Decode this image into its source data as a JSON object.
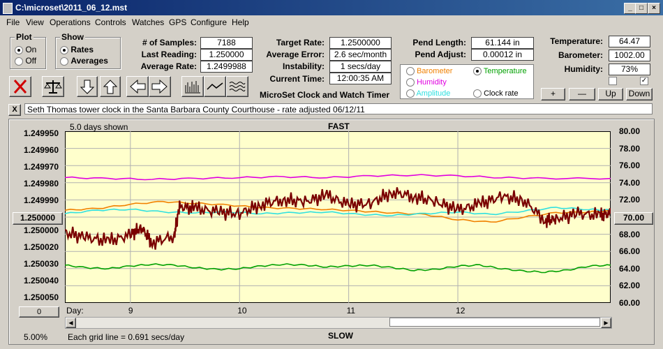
{
  "window": {
    "title": "C:\\microset\\2011_06_12.mst"
  },
  "menu": [
    "File",
    "View",
    "Operations",
    "Controls",
    "Watches",
    "GPS",
    "Configure",
    "Help"
  ],
  "plot_group": {
    "title": "Plot",
    "on": "On",
    "off": "Off"
  },
  "show_group": {
    "title": "Show",
    "rates": "Rates",
    "averages": "Averages"
  },
  "stats": {
    "samples_label": "# of Samples:",
    "samples": "7188",
    "last_label": "Last Reading:",
    "last": "1.250000",
    "avg_label": "Average Rate:",
    "avg": "1.2499988",
    "target_label": "Target Rate:",
    "target": "1.2500000",
    "err_label": "Average Error:",
    "err": "2.6 sec/month",
    "inst_label": "Instability:",
    "inst": "1 secs/day",
    "time_label": "Current Time:",
    "time": "12:00:35 AM",
    "pend_len_label": "Pend Length:",
    "pend_len": "61.144 in",
    "pend_adj_label": "Pend Adjust:",
    "pend_adj": "0.00012 in",
    "temp_label": "Temperature:",
    "temp": "64.47",
    "baro_label": "Barometer:",
    "baro": "1002.00",
    "hum_label": "Humidity:",
    "hum": "73%"
  },
  "app_label": "MicroSet Clock and Watch Timer",
  "series_select": {
    "barometer": "Barometer",
    "temperature": "Temperature",
    "humidity": "Humidity",
    "amplitude": "Amplitude",
    "clock_rate": "Clock rate"
  },
  "buttons": {
    "plus": "+",
    "minus": "—",
    "up": "Up",
    "down": "Down",
    "close_x": "X"
  },
  "comment": "Seth Thomas tower clock in the Santa Barbara County Courthouse - rate adjusted 06/12/11",
  "chart_top": {
    "days_shown": "5.0 days shown",
    "fast": "FAST",
    "slow": "SLOW"
  },
  "left_controls": {
    "center_value": "1.250000",
    "offset_value": "0"
  },
  "right_controls": {
    "center_value": "70.00"
  },
  "status": {
    "zoom": "5.00%",
    "grid": "Each grid line = 0.691 secs/day"
  },
  "colors": {
    "clock_rate": "#7a0000",
    "temperature": "#00a000",
    "humidity": "#e000e0",
    "barometer": "#f08000",
    "amplitude": "#30e0e0",
    "plot_bg": "#ffffcc"
  },
  "chart_data": {
    "type": "line",
    "xlabel": "Day:",
    "x_ticks": [
      "9",
      "10",
      "11",
      "12"
    ],
    "x_range": [
      8.4,
      13.4
    ],
    "y_left_ticks": [
      "1.249950",
      "1.249960",
      "1.249970",
      "1.249980",
      "1.249990",
      "1.250000",
      "1.250020",
      "1.250030",
      "1.250040",
      "1.250050"
    ],
    "y_right_ticks": [
      "80.00",
      "78.00",
      "76.00",
      "74.00",
      "72.00",
      "70.00",
      "68.00",
      "66.00",
      "64.00",
      "62.00",
      "60.00"
    ],
    "ylim_right": [
      60,
      80
    ],
    "grid": true,
    "series": [
      {
        "name": "Humidity",
        "x": [
          8.4,
          8.8,
          9.2,
          9.6,
          10.0,
          10.4,
          10.8,
          11.2,
          11.6,
          12.0,
          12.4,
          12.8,
          13.4
        ],
        "values": [
          74.6,
          74.5,
          74.4,
          74.5,
          74.6,
          74.7,
          74.6,
          74.8,
          74.9,
          74.8,
          74.6,
          74.5,
          74.5
        ]
      },
      {
        "name": "Temperature",
        "x": [
          8.4,
          8.6,
          8.8,
          9.0,
          9.2,
          9.4,
          9.6,
          9.8,
          10.0,
          10.2,
          10.4,
          10.6,
          10.8,
          11.0,
          11.2,
          11.4,
          11.6,
          11.8,
          12.0,
          12.2,
          12.4,
          12.6,
          12.8,
          13.0,
          13.2,
          13.4
        ],
        "values": [
          64.4,
          64.1,
          64.0,
          64.3,
          64.5,
          64.4,
          64.1,
          63.9,
          64.0,
          64.3,
          64.5,
          64.4,
          64.2,
          64.3,
          64.4,
          64.1,
          63.8,
          63.9,
          64.3,
          64.4,
          64.0,
          63.7,
          63.6,
          63.8,
          64.3,
          64.4
        ]
      },
      {
        "name": "Barometer",
        "x": [
          8.4,
          8.7,
          9.0,
          9.3,
          9.6,
          9.9,
          10.2,
          10.5,
          10.8,
          11.1,
          11.4,
          11.7,
          12.0,
          12.3,
          12.6,
          12.9,
          13.2,
          13.4
        ],
        "values": [
          70.8,
          71.0,
          71.5,
          71.8,
          71.6,
          71.4,
          71.1,
          71.0,
          70.9,
          70.7,
          70.5,
          70.3,
          69.7,
          69.4,
          70.0,
          70.5,
          70.6,
          70.7
        ]
      },
      {
        "name": "Amplitude",
        "x": [
          8.4,
          8.7,
          9.0,
          9.3,
          9.6,
          9.9,
          10.2,
          10.5,
          10.8,
          11.1,
          11.4,
          11.7,
          12.0,
          12.3,
          12.6,
          12.9,
          13.2,
          13.4
        ],
        "values": [
          70.4,
          70.8,
          70.9,
          70.6,
          70.5,
          70.6,
          70.4,
          70.5,
          70.6,
          70.3,
          70.2,
          70.4,
          70.6,
          70.3,
          70.7,
          71.1,
          70.9,
          70.8
        ]
      },
      {
        "name": "Clock rate",
        "x": [
          8.4,
          8.6,
          8.8,
          9.0,
          9.1,
          9.2,
          9.4,
          9.45,
          9.6,
          9.8,
          10.0,
          10.2,
          10.4,
          10.6,
          10.8,
          11.0,
          11.2,
          11.4,
          11.6,
          11.8,
          12.0,
          12.2,
          12.4,
          12.6,
          12.8,
          12.9,
          13.1,
          13.3,
          13.4
        ],
        "values": [
          68.2,
          67.6,
          67.2,
          67.9,
          68.8,
          67.0,
          67.8,
          71.2,
          71.0,
          70.6,
          70.4,
          71.5,
          72.0,
          71.8,
          72.5,
          71.4,
          71.6,
          72.9,
          72.4,
          71.8,
          70.8,
          71.5,
          72.4,
          72.0,
          69.6,
          69.8,
          70.4,
          70.2,
          70.4
        ]
      }
    ]
  }
}
